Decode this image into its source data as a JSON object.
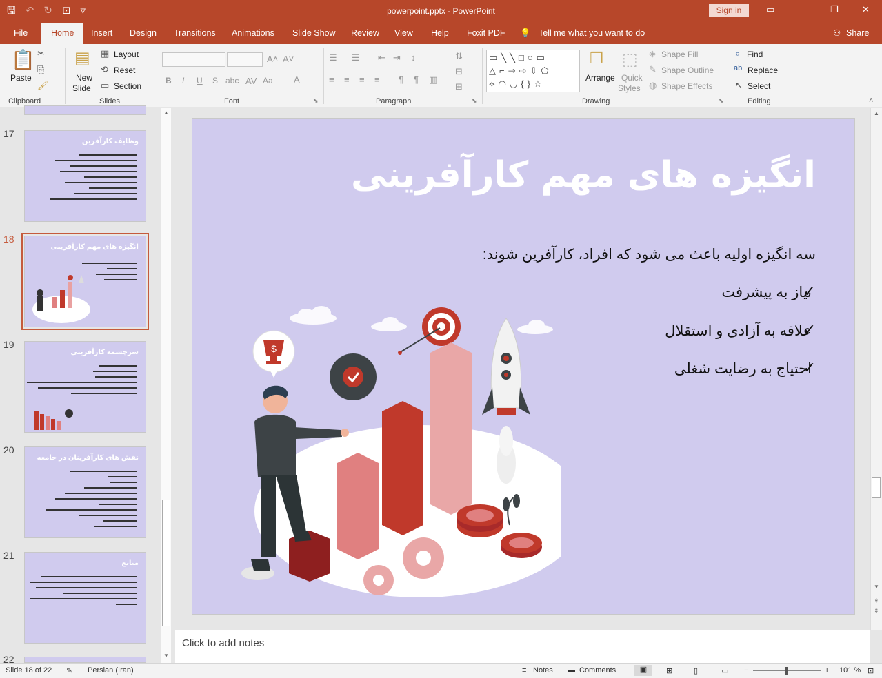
{
  "window": {
    "doc_title": "powerpoint.pptx  -  PowerPoint",
    "sign_in": "Sign in",
    "minimize": "—",
    "restore": "❐",
    "close": "✕"
  },
  "tabs": [
    "File",
    "Home",
    "Insert",
    "Design",
    "Transitions",
    "Animations",
    "Slide Show",
    "Review",
    "View",
    "Help",
    "Foxit PDF",
    "Tell me what you want to do",
    "Share"
  ],
  "ribbon": {
    "clipboard": {
      "paste": "Paste",
      "label": "Clipboard"
    },
    "slides": {
      "new_slide_1": "New",
      "new_slide_2": "Slide",
      "layout": "Layout",
      "reset": "Reset",
      "section": "Section",
      "label": "Slides"
    },
    "font": {
      "label": "Font",
      "bold": "B",
      "italic": "I",
      "underline": "U",
      "shadow": "S",
      "strike": "abc",
      "aa": "Aa"
    },
    "paragraph": {
      "label": "Paragraph"
    },
    "drawing": {
      "arrange": "Arrange",
      "quick_styles_1": "Quick",
      "quick_styles_2": "Styles",
      "shape_fill": "Shape Fill",
      "shape_outline": "Shape Outline",
      "shape_effects": "Shape Effects",
      "label": "Drawing"
    },
    "editing": {
      "find": "Find",
      "replace": "Replace",
      "select": "Select",
      "label": "Editing"
    }
  },
  "thumbnails": [
    {
      "num": "17",
      "title": "وظایف کارآفرین"
    },
    {
      "num": "18",
      "title": "انگیزه های مهم کارآفرینی"
    },
    {
      "num": "19",
      "title": "سرچشمه کارآفرینی"
    },
    {
      "num": "20",
      "title": "نقش های کارآفرینان در جامعه"
    },
    {
      "num": "21",
      "title": "منابع"
    },
    {
      "num": "22",
      "title": ""
    }
  ],
  "slide": {
    "title": "انگیزه های مهم کارآفرینی",
    "subtitle": "سه انگیزه اولیه باعث می شود که افراد، کارآفرین شوند:",
    "bullets": [
      "نیاز به پیشرفت",
      "علاقه به آزادی و استقلال",
      "احتیاج به رضایت شغلی"
    ],
    "check": "✓",
    "colors": {
      "background": "#d0cbee",
      "title": "#ffffff",
      "accent": "#c0392b"
    }
  },
  "notes_placeholder": "Click to add notes",
  "status": {
    "slide_info": "Slide 18 of 22",
    "language": "Persian (Iran)",
    "notes": "Notes",
    "comments": "Comments",
    "zoom": "101 %"
  }
}
